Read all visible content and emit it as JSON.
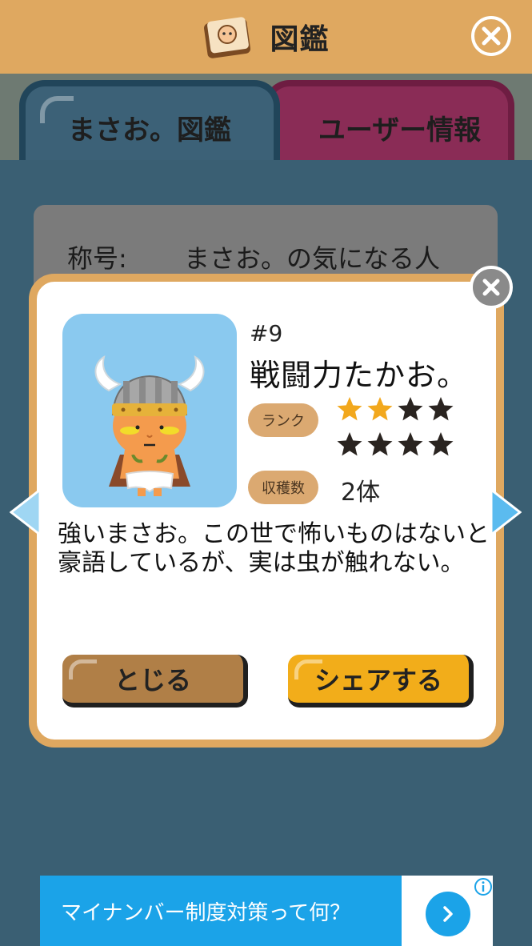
{
  "header": {
    "title": "図鑑",
    "icon": "book-icon",
    "close_icon": "close-icon"
  },
  "tabs": [
    {
      "label": "まさお。図鑑",
      "active": true
    },
    {
      "label": "ユーザー情報",
      "active": false
    }
  ],
  "title_panel": {
    "label": "称号:",
    "value": "まさお。の気になる人"
  },
  "modal": {
    "number": "#9",
    "name": "戦闘力たかお。",
    "rank_label": "ランク",
    "rank": {
      "filled": 2,
      "total": 8
    },
    "count_label": "収穫数",
    "count_value": "2体",
    "description": "強いまさお。この世で怖いものはないと豪語しているが、実は虫が触れない。",
    "close_button": "とじる",
    "share_button": "シェアする"
  },
  "ad": {
    "text": "マイナンバー制度対策って何？",
    "go_icon": "chevron-right-icon",
    "info_icon": "info-icon"
  },
  "colors": {
    "header": "#dfa860",
    "background": "#3a5f73",
    "star_filled": "#f2a81d",
    "star_empty": "#2a2420",
    "share": "#f2ad1a",
    "close": "#b07f47"
  }
}
